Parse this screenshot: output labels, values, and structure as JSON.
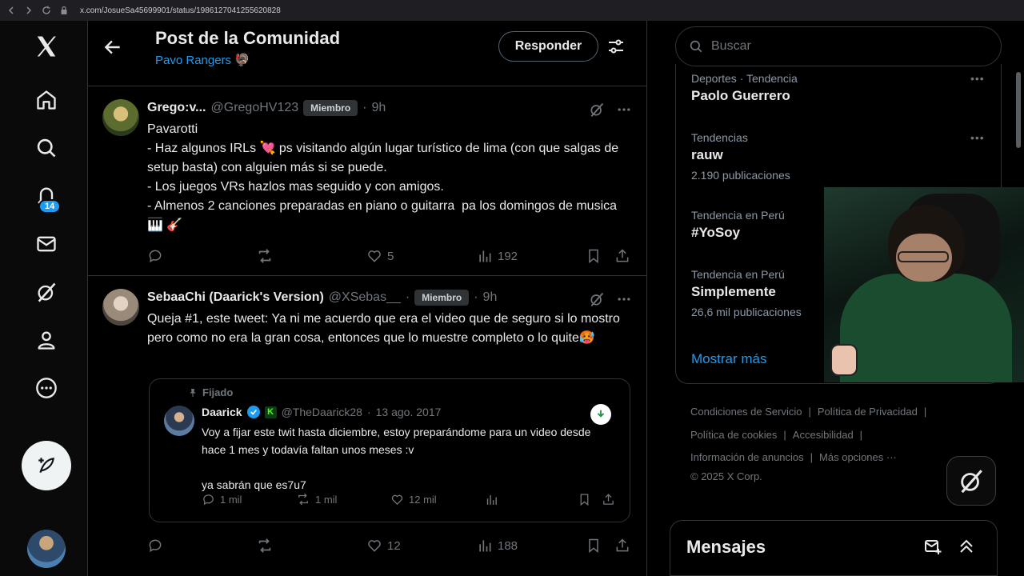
{
  "browser": {
    "url": "x.com/JosueSa45699901/status/1986127041255620828"
  },
  "nav": {
    "notifications_count": "14"
  },
  "header": {
    "title": "Post de la Comunidad",
    "community": "Pavo Rangers",
    "reply_button": "Responder"
  },
  "tweets": [
    {
      "name": "Grego:v...",
      "handle": "@GregoHV123",
      "badge": "Miembro",
      "time": "9h",
      "text": "Pavarotti\n- Haz algunos IRLs 💘 ps visitando algún lugar turístico de lima (con que salgas de setup basta) con alguien más si se puede.\n- Los juegos VRs hazlos mas seguido y con amigos.\n- Almenos 2 canciones preparadas en piano o guitarra  pa los domingos de musica 🎹 🎸",
      "replies": "",
      "reposts": "",
      "likes": "5",
      "views": "192"
    },
    {
      "name": "SebaaChi (Daarick's Version)",
      "handle": "@XSebas__",
      "badge": "Miembro",
      "time": "9h",
      "text": "Queja #1, este tweet: Ya ni me acuerdo que era el video que de seguro si lo mostro pero como no era la gran cosa, entonces que lo muestre completo o lo quite🥵",
      "replies": "",
      "reposts": "",
      "likes": "12",
      "views": "188"
    }
  ],
  "quote": {
    "pinned_label": "Fijado",
    "name": "Daarick",
    "handle": "@TheDaarick28",
    "date": "13 ago. 2017",
    "text": "Voy a fijar este twit hasta diciembre, estoy preparándome para un video desde hace 1 mes y todavía faltan unos meses :v\n\nya sabrán que es7u7",
    "replies": "1 mil",
    "reposts": "1 mil",
    "likes": "12 mil"
  },
  "search": {
    "placeholder": "Buscar"
  },
  "trends": [
    {
      "category": "Deportes · Tendencia",
      "name": "Paolo Guerrero",
      "count": ""
    },
    {
      "category": "Tendencias",
      "name": "rauw",
      "count": "2.190 publicaciones"
    },
    {
      "category": "Tendencia en Perú",
      "name": "#YoSoy",
      "count": ""
    },
    {
      "category": "Tendencia en Perú",
      "name": "Simplemente",
      "count": "26,6 mil publicaciones"
    }
  ],
  "show_more": "Mostrar más",
  "footer": {
    "row1": [
      "Condiciones de Servicio",
      "Política de Privacidad"
    ],
    "row2": [
      "Política de cookies",
      "Accesibilidad"
    ],
    "row3": [
      "Información de anuncios",
      "Más opciones ···"
    ],
    "copyright": "© 2025 X Corp."
  },
  "messages": {
    "title": "Mensajes"
  },
  "colors": {
    "accent": "#1d9bf0",
    "background": "#000000",
    "border": "#2f3336",
    "muted": "#71767b"
  }
}
